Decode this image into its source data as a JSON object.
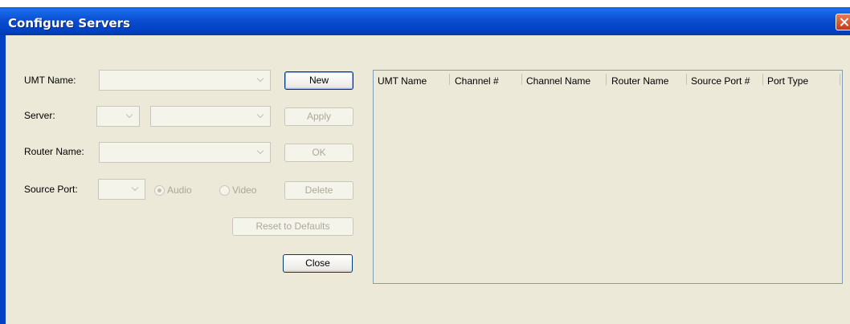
{
  "window": {
    "title": "Configure Servers"
  },
  "form": {
    "umt_name_label": "UMT Name:",
    "server_label": "Server:",
    "router_name_label": "Router Name:",
    "source_port_label": "Source Port:",
    "audio_label": "Audio",
    "video_label": "Video",
    "audio_selected": true
  },
  "buttons": {
    "new": "New",
    "apply": "Apply",
    "ok": "OK",
    "delete": "Delete",
    "reset": "Reset to Defaults",
    "close": "Close"
  },
  "table": {
    "columns": [
      "UMT Name",
      "Channel #",
      "Channel Name",
      "Router Name",
      "Source Port #",
      "Port Type"
    ],
    "rows": []
  },
  "colors": {
    "titlebar": "#0054e3",
    "client": "#ece9d8"
  }
}
